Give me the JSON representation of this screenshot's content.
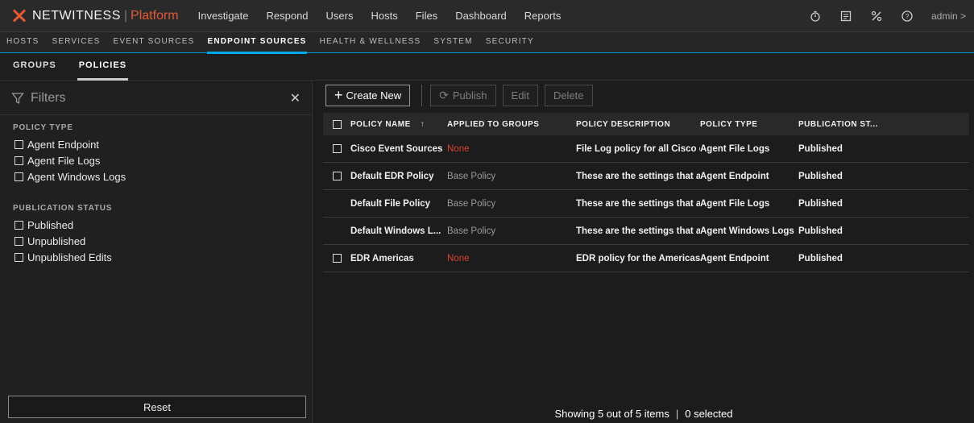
{
  "app": {
    "brand": "NETWITNESS",
    "product": "Platform",
    "brand_color": "#e35a35"
  },
  "topnav": {
    "items": [
      "Investigate",
      "Respond",
      "Users",
      "Hosts",
      "Files",
      "Dashboard",
      "Reports"
    ]
  },
  "topright": {
    "icons": [
      "timer-icon",
      "notes-icon",
      "tools-icon",
      "help-icon"
    ],
    "user": "admin >"
  },
  "subnav": {
    "items": [
      "HOSTS",
      "SERVICES",
      "EVENT SOURCES",
      "ENDPOINT SOURCES",
      "HEALTH & WELLNESS",
      "SYSTEM",
      "SECURITY"
    ],
    "active": "ENDPOINT SOURCES",
    "accent": "#00a8e8"
  },
  "tabs": {
    "items": [
      "GROUPS",
      "POLICIES"
    ],
    "active": "POLICIES"
  },
  "filters": {
    "title": "Filters",
    "policy_type_title": "POLICY TYPE",
    "policy_types": [
      "Agent Endpoint",
      "Agent File Logs",
      "Agent Windows Logs"
    ],
    "publication_status_title": "PUBLICATION STATUS",
    "publication_statuses": [
      "Published",
      "Unpublished",
      "Unpublished Edits"
    ],
    "reset_label": "Reset"
  },
  "toolbar": {
    "create_label": "Create New",
    "publish_label": "Publish",
    "edit_label": "Edit",
    "delete_label": "Delete"
  },
  "table": {
    "columns": [
      "POLICY NAME",
      "APPLIED TO GROUPS",
      "POLICY DESCRIPTION",
      "POLICY TYPE",
      "PUBLICATION ST..."
    ],
    "rows": [
      {
        "name": "Cisco Event Sources",
        "groups": "None",
        "groups_style": "none",
        "description": "File Log policy for all Cisco d...",
        "type": "Agent File Logs",
        "status": "Published",
        "checkbox": true
      },
      {
        "name": "Default EDR Policy",
        "groups": "Base Policy",
        "groups_style": "muted",
        "description": "These are the settings that a...",
        "type": "Agent Endpoint",
        "status": "Published",
        "checkbox": true
      },
      {
        "name": "Default File Policy",
        "groups": "Base Policy",
        "groups_style": "muted",
        "description": "These are the settings that a...",
        "type": "Agent File Logs",
        "status": "Published",
        "checkbox": false
      },
      {
        "name": "Default Windows L...",
        "groups": "Base Policy",
        "groups_style": "muted",
        "description": "These are the settings that a...",
        "type": "Agent Windows Logs",
        "status": "Published",
        "checkbox": false
      },
      {
        "name": "EDR Americas",
        "groups": "None",
        "groups_style": "none",
        "description": "EDR policy for the Americas",
        "type": "Agent Endpoint",
        "status": "Published",
        "checkbox": true
      }
    ]
  },
  "footer": {
    "showing": "Showing 5 out of 5 items",
    "selected": "0 selected"
  }
}
